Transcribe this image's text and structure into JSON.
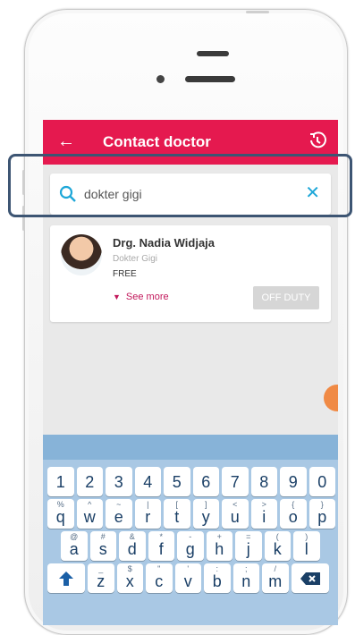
{
  "app_bar": {
    "back_glyph": "←",
    "title": "Contact doctor",
    "history_icon": "history-icon"
  },
  "search": {
    "value": "dokter gigi",
    "clear_glyph": "✕"
  },
  "doctor_card": {
    "name": "Drg. Nadia Widjaja",
    "specialty": "Dokter Gigi",
    "fee": "FREE",
    "see_more": "See more",
    "status_button": "OFF DUTY"
  },
  "colors": {
    "app_bar": "#e5194f",
    "accent_search": "#1ea7d8",
    "see_more": "#c2185b",
    "keyboard_bg": "#a9c8e4"
  },
  "keyboard": {
    "row_numbers": [
      "1",
      "2",
      "3",
      "4",
      "5",
      "6",
      "7",
      "8",
      "9",
      "0"
    ],
    "row1": [
      {
        "main": "q",
        "alt": "%"
      },
      {
        "main": "w",
        "alt": "^"
      },
      {
        "main": "e",
        "alt": "~"
      },
      {
        "main": "r",
        "alt": "|"
      },
      {
        "main": "t",
        "alt": "["
      },
      {
        "main": "y",
        "alt": "]"
      },
      {
        "main": "u",
        "alt": "<"
      },
      {
        "main": "i",
        "alt": ">"
      },
      {
        "main": "o",
        "alt": "{"
      },
      {
        "main": "p",
        "alt": "}"
      }
    ],
    "row2": [
      {
        "main": "a",
        "alt": "@"
      },
      {
        "main": "s",
        "alt": "#"
      },
      {
        "main": "d",
        "alt": "&"
      },
      {
        "main": "f",
        "alt": "*"
      },
      {
        "main": "g",
        "alt": "-"
      },
      {
        "main": "h",
        "alt": "+"
      },
      {
        "main": "j",
        "alt": "="
      },
      {
        "main": "k",
        "alt": "("
      },
      {
        "main": "l",
        "alt": ")"
      }
    ],
    "row3": [
      {
        "main": "z",
        "alt": "_"
      },
      {
        "main": "x",
        "alt": "$"
      },
      {
        "main": "c",
        "alt": "\""
      },
      {
        "main": "v",
        "alt": "'"
      },
      {
        "main": "b",
        "alt": ":"
      },
      {
        "main": "n",
        "alt": ";"
      },
      {
        "main": "m",
        "alt": "/"
      }
    ]
  }
}
